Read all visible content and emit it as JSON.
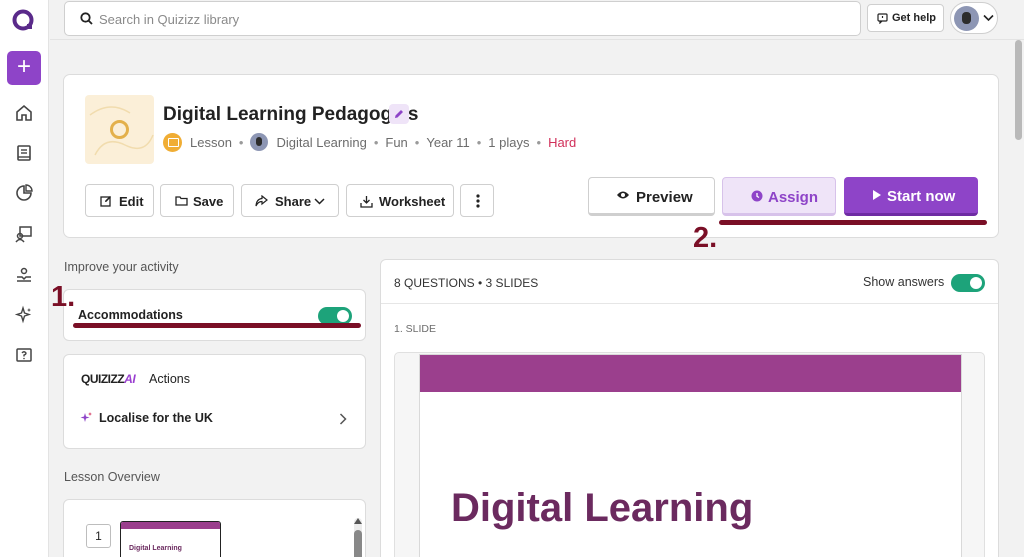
{
  "search": {
    "placeholder": "Search in Quizizz library"
  },
  "header": {
    "help_label": "Get help"
  },
  "rail": {
    "create_label": "+"
  },
  "activity": {
    "title": "Digital Learning Pedagogies",
    "type": "Lesson",
    "author": "Digital Learning",
    "subject": "Fun",
    "grade": "Year 11",
    "plays": "1 plays",
    "difficulty": "Hard"
  },
  "actions": {
    "edit": "Edit",
    "save": "Save",
    "share": "Share",
    "worksheet": "Worksheet",
    "preview": "Preview",
    "assign": "Assign",
    "start_now": "Start now"
  },
  "annotations": {
    "step1": "1.",
    "step2": "2."
  },
  "improve": {
    "heading": "Improve your activity",
    "accommodations_label": "Accommodations",
    "accommodations_on": true,
    "ai_brand_text": "QUIZIZZ",
    "ai_brand_ai": "AI",
    "ai_actions_label": "Actions",
    "localise_label": "Localise for the UK"
  },
  "overview": {
    "heading": "Lesson Overview",
    "items": [
      {
        "number": "1",
        "thumb_title": "Digital Learning"
      }
    ]
  },
  "questions": {
    "count_label": "8 QUESTIONS • 3 SLIDES",
    "show_answers_label": "Show answers",
    "show_answers_on": true,
    "slide_label": "1. SLIDE",
    "slide_title": "Digital Learning"
  },
  "colors": {
    "brand_purple": "#8e44c8",
    "toggle_green": "#1da37a",
    "annotation_red": "#7a0f26",
    "difficulty_hard": "#d1305a",
    "slide_band": "#9b3f8d"
  }
}
